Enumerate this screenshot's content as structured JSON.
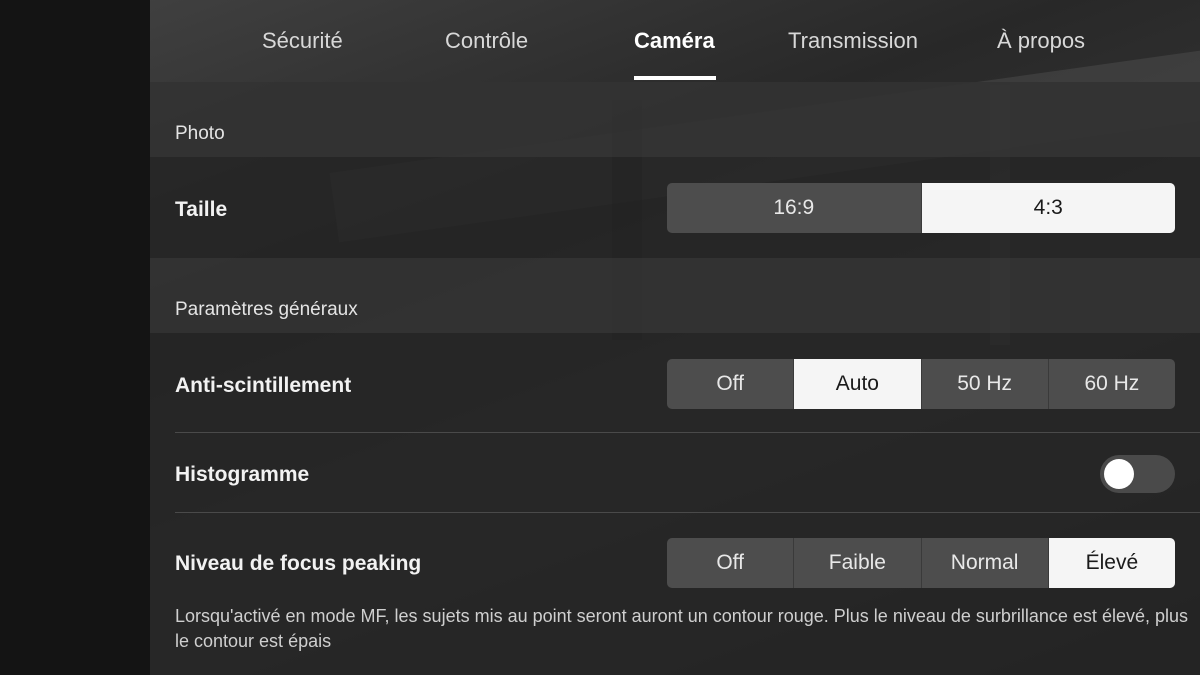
{
  "tabs": [
    {
      "label": "Sécurité",
      "active": false
    },
    {
      "label": "Contrôle",
      "active": false
    },
    {
      "label": "Caméra",
      "active": true
    },
    {
      "label": "Transmission",
      "active": false
    },
    {
      "label": "À propos",
      "active": false
    }
  ],
  "photo": {
    "section_title": "Photo",
    "size": {
      "label": "Taille",
      "options": [
        "16:9",
        "4:3"
      ],
      "selected": "4:3"
    }
  },
  "general": {
    "section_title": "Paramètres généraux",
    "anti_flicker": {
      "label": "Anti-scintillement",
      "options": [
        "Off",
        "Auto",
        "50 Hz",
        "60 Hz"
      ],
      "selected": "Auto"
    },
    "histogram": {
      "label": "Histogramme",
      "enabled": false
    },
    "focus_peaking": {
      "label": "Niveau de focus peaking",
      "options": [
        "Off",
        "Faible",
        "Normal",
        "Élevé"
      ],
      "selected": "Élevé",
      "description": "Lorsqu'activé en mode MF, les sujets mis au point seront auront un contour rouge. Plus le niveau de surbrillance est élevé, plus le contour est épais"
    }
  }
}
